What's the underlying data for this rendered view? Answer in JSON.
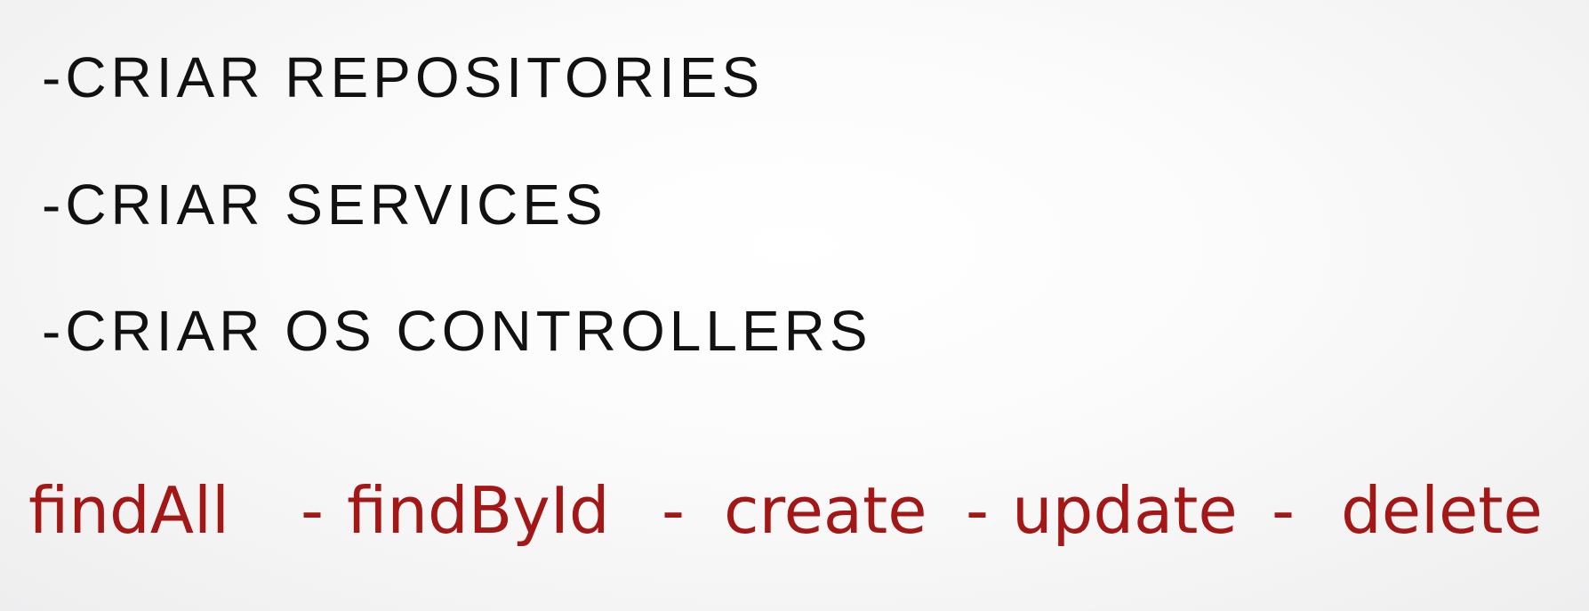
{
  "items": [
    "-CRIAR REPOSITORIES",
    "-CRIAR SERVICES",
    "-CRIAR OS CONTROLLERS"
  ],
  "methods": {
    "findall": "findAll",
    "findbyid": "findById",
    "create": "create",
    "update": "update",
    "delete": "delete",
    "separator": "-"
  },
  "colors": {
    "text": "#111111",
    "accent": "#a31717"
  }
}
